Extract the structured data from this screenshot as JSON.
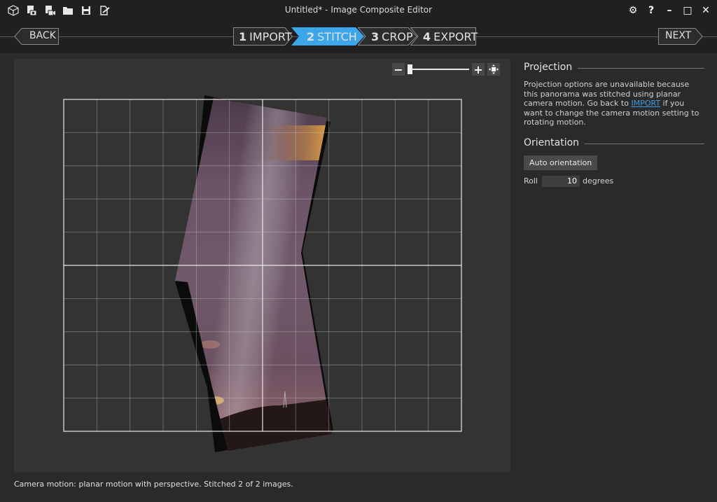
{
  "window": {
    "title": "Untitled* - Image Composite Editor"
  },
  "toolbar_icons": [
    "new-project-icon",
    "new-panorama-from-images-icon",
    "new-panorama-from-video-icon",
    "open-project-icon",
    "save-project-icon",
    "publish-icon"
  ],
  "window_controls": {
    "settings": "⚙",
    "help": "?",
    "minimize": "–",
    "maximize": "□",
    "close": "✕"
  },
  "nav": {
    "back_label": "BACK",
    "next_label": "NEXT",
    "steps": [
      {
        "num": "1",
        "label": "IMPORT",
        "active": false
      },
      {
        "num": "2",
        "label": "STITCH",
        "active": true
      },
      {
        "num": "3",
        "label": "CROP",
        "active": false
      },
      {
        "num": "4",
        "label": "EXPORT",
        "active": false
      }
    ]
  },
  "zoom": {
    "minus": "−",
    "plus": "+",
    "level": 0.0
  },
  "projection": {
    "heading": "Projection",
    "text_before": "Projection options are unavailable because this panorama was stitched using planar camera motion. Go back to ",
    "link": "IMPORT",
    "text_after": " if you want to change the camera motion setting to rotating motion."
  },
  "orientation": {
    "heading": "Orientation",
    "auto_label": "Auto orientation",
    "roll_label": "Roll",
    "roll_value": "10",
    "roll_unit": "degrees"
  },
  "status": "Camera motion: planar motion with perspective. Stitched 2 of 2 images.",
  "colors": {
    "accent": "#3ba7ea",
    "background": "#2a2a2a",
    "canvas": "#333333",
    "link": "#3c9ce8"
  }
}
